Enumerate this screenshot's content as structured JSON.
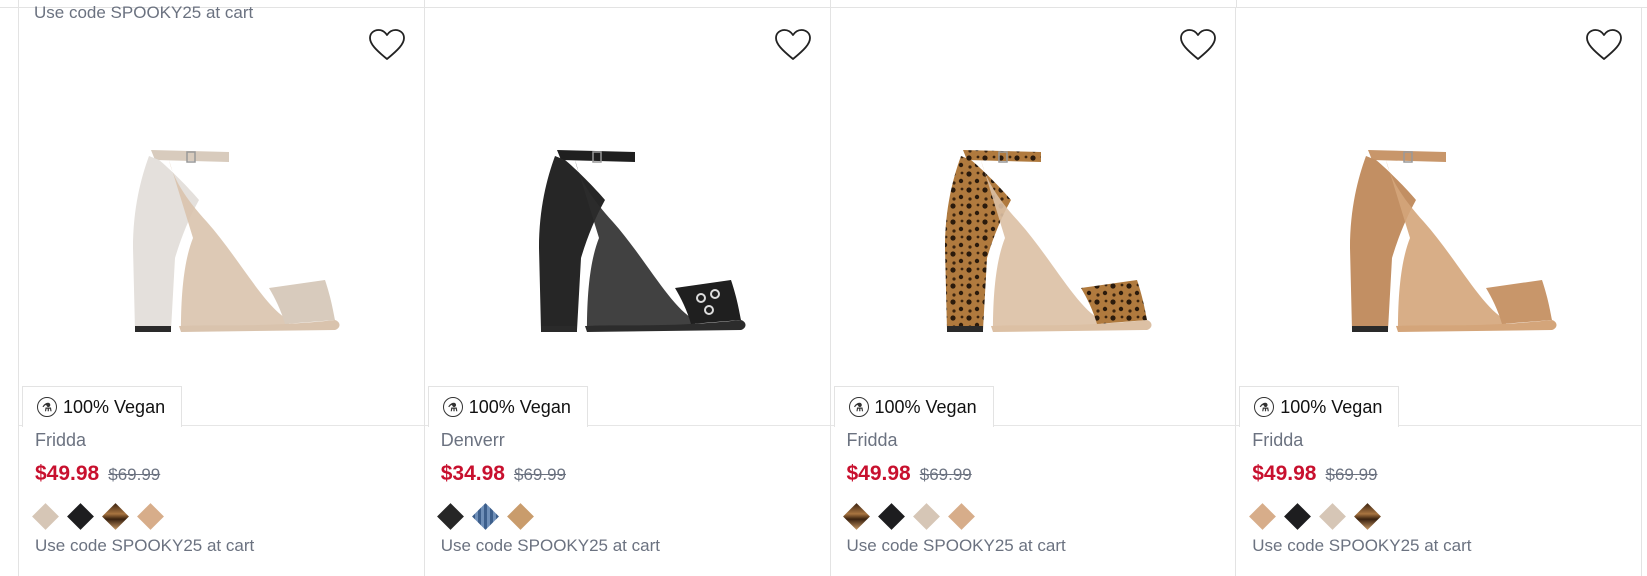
{
  "top_strip": {
    "promo": "Use code SPOOKY25 at cart"
  },
  "products": [
    {
      "name": "Fridda",
      "sale_price": "$49.98",
      "original_price": "$69.99",
      "badge": "100% Vegan",
      "promo": "Use code SPOOKY25 at cart",
      "image_icon": "nude-rhinestone-heel-sandal",
      "colors": {
        "upper": "#d8cbbd",
        "heel": "#e4e0dc",
        "sole": "#d9c3ad"
      },
      "swatches": [
        "#d6c6b6",
        "#1d1d1f",
        "leopard",
        "#d7ad8a"
      ]
    },
    {
      "name": "Denverr",
      "sale_price": "$34.98",
      "original_price": "$69.99",
      "badge": "100% Vegan",
      "promo": "Use code SPOOKY25 at cart",
      "image_icon": "black-grommet-heel-sandal",
      "colors": {
        "upper": "#1f1f1f",
        "heel": "#262626",
        "sole": "#2c2c2c"
      },
      "swatches": [
        "#262626",
        "denim",
        "#c99c6c"
      ]
    },
    {
      "name": "Fridda",
      "sale_price": "$49.98",
      "original_price": "$69.99",
      "badge": "100% Vegan",
      "promo": "Use code SPOOKY25 at cart",
      "image_icon": "leopard-heel-sandal",
      "colors": {
        "upper": "#8a5a2b",
        "heel": "#5a3518",
        "sole": "#dcc0a4"
      },
      "swatches": [
        "leopard",
        "#1d1d1f",
        "#d6c6b6",
        "#d7ad8a"
      ]
    },
    {
      "name": "Fridda",
      "sale_price": "$49.98",
      "original_price": "$69.99",
      "badge": "100% Vegan",
      "promo": "Use code SPOOKY25 at cart",
      "image_icon": "tan-heel-sandal",
      "colors": {
        "upper": "#c8966a",
        "heel": "#c28f63",
        "sole": "#d4a57a"
      },
      "swatches": [
        "#d7ad8a",
        "#1d1d1f",
        "#d6c6b6",
        "leopard"
      ]
    }
  ]
}
